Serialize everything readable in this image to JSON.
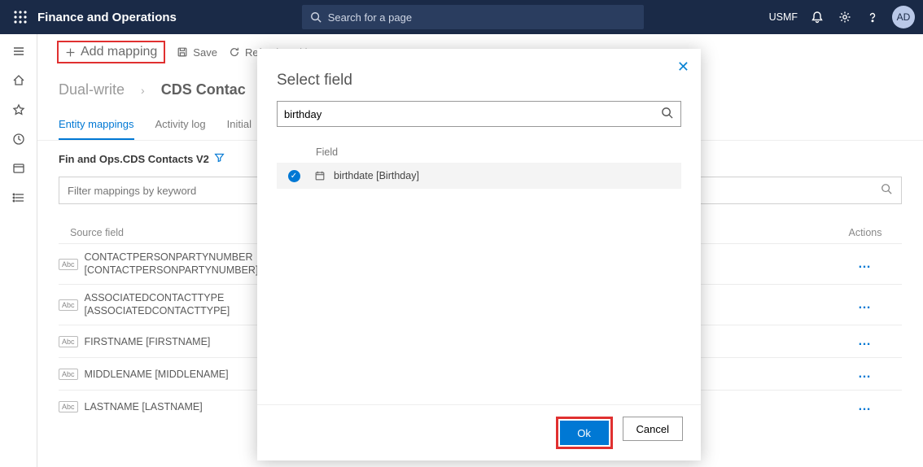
{
  "topbar": {
    "app_title": "Finance and Operations",
    "search_placeholder": "Search for a page",
    "company": "USMF",
    "avatar_initials": "AD"
  },
  "cmdbar": {
    "add_mapping": "Add mapping",
    "save": "Save",
    "refresh": "Refresh entities"
  },
  "breadcrumb": {
    "root": "Dual-write",
    "current": "CDS Contac"
  },
  "tabs": {
    "entity_mappings": "Entity mappings",
    "activity_log": "Activity log",
    "initial": "Initial"
  },
  "subtitle": "Fin and Ops.CDS Contacts V2",
  "filter_placeholder": "Filter mappings by keyword",
  "columns": {
    "source": "Source field",
    "actions": "Actions"
  },
  "rows": [
    {
      "text": "CONTACTPERSONPARTYNUMBER\n[CONTACTPERSONPARTYNUMBER]",
      "tall": true
    },
    {
      "text": "ASSOCIATEDCONTACTTYPE\n[ASSOCIATEDCONTACTTYPE]",
      "tall": true
    },
    {
      "text": "FIRSTNAME [FIRSTNAME]",
      "tall": false
    },
    {
      "text": "MIDDLENAME [MIDDLENAME]",
      "tall": false
    },
    {
      "text": "LASTNAME [LASTNAME]",
      "tall": false
    }
  ],
  "modal": {
    "title": "Select field",
    "search_value": "birthday",
    "column_header": "Field",
    "result": "birthdate [Birthday]",
    "ok": "Ok",
    "cancel": "Cancel"
  },
  "badge_text": "Abc",
  "dots": "…"
}
